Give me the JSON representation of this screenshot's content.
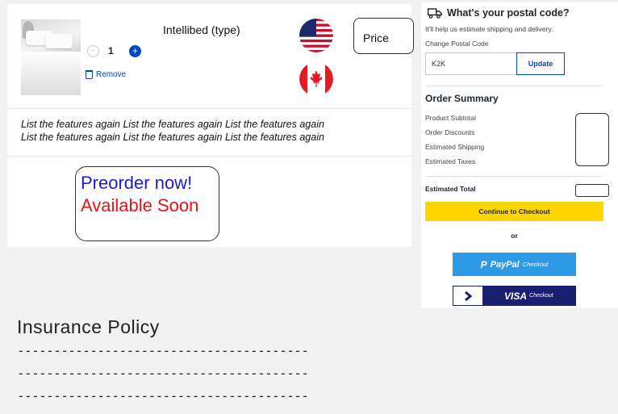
{
  "cart": {
    "product_name": "Intellibed (type)",
    "quantity": "1",
    "minus_symbol": "−",
    "plus_symbol": "+",
    "remove_label": "Remove",
    "price_label": "Price",
    "features": [
      "List the features again List the features again List the features again",
      "List the features again List the features again List the features again"
    ],
    "preorder_line1": "Preorder now!",
    "preorder_line2": "Available Soon",
    "flags": [
      "us-flag-icon",
      "canada-flag-icon"
    ]
  },
  "postal": {
    "title": "What's your postal code?",
    "help": "It'll help us estimate shipping and delivery.",
    "change_label": "Change Postal Code",
    "value": "K2K",
    "update_label": "Update"
  },
  "summary": {
    "title": "Order Summary",
    "rows": [
      "Product Subtotal",
      "Order Discounts",
      "Estimated Shipping",
      "Estimated Taxes"
    ],
    "total_label": "Estimated Total",
    "checkout_label": "Continue to Checkout",
    "or_label": "or",
    "paypal_brand": "PayPal",
    "paypal_suffix": "Checkout",
    "visa_brand": "VISA",
    "visa_suffix": "Checkout"
  },
  "insurance": {
    "title": "Insurance Policy",
    "lines": [
      "----------------------------------------",
      "----------------------------------------",
      "----------------------------------------"
    ]
  },
  "colors": {
    "accent_blue": "#0046be",
    "checkout_yellow": "#ffd500",
    "paypal_blue": "#2c9ae4",
    "visa_navy": "#1a1f71",
    "preorder_blue": "#1a1adb",
    "preorder_red": "#e6131a"
  }
}
